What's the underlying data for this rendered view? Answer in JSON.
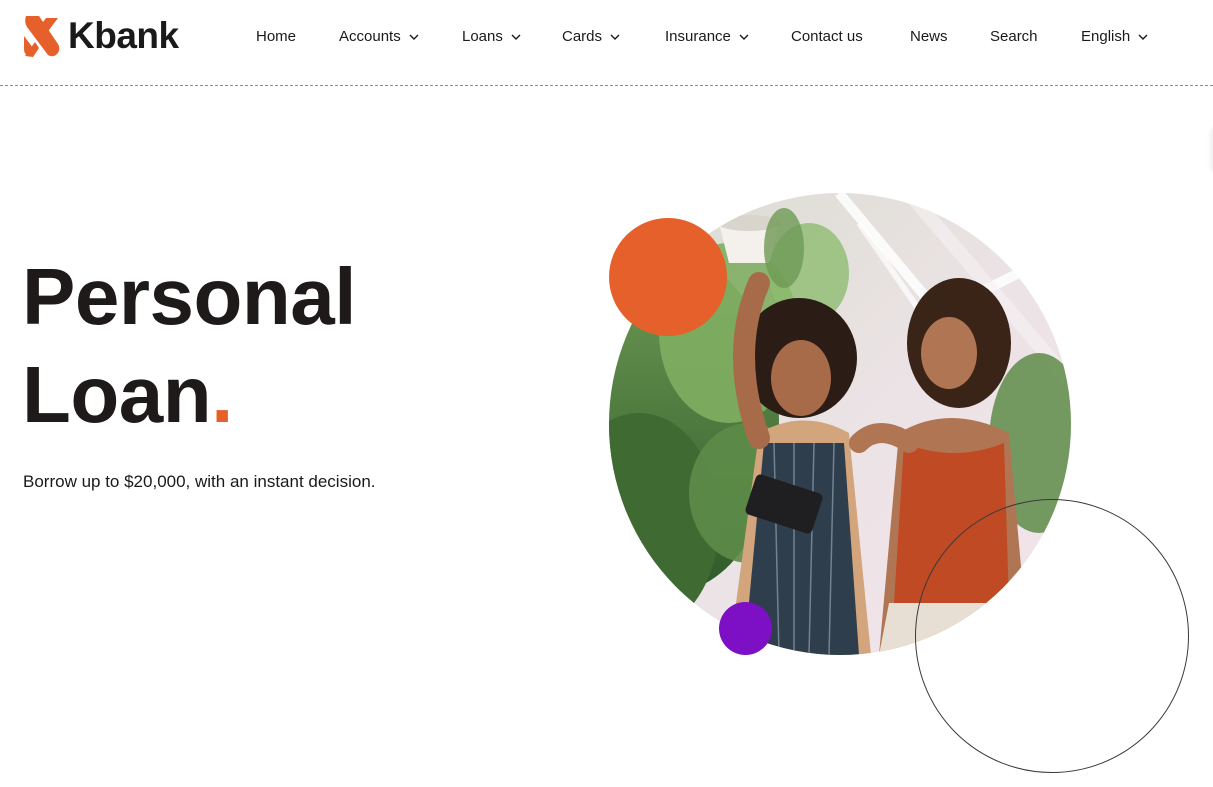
{
  "brand": {
    "name": "Kbank",
    "accent_color": "#e5602a",
    "secondary_color": "#7d0fc4",
    "logo_icon": "kbank-k-logo-icon"
  },
  "nav": {
    "items": [
      {
        "label": "Home",
        "has_dropdown": false
      },
      {
        "label": "Accounts",
        "has_dropdown": true
      },
      {
        "label": "Loans",
        "has_dropdown": true
      },
      {
        "label": "Cards",
        "has_dropdown": true
      },
      {
        "label": "Insurance",
        "has_dropdown": true
      },
      {
        "label": "Contact us",
        "has_dropdown": false
      },
      {
        "label": "News",
        "has_dropdown": false
      },
      {
        "label": "Search",
        "has_dropdown": false
      },
      {
        "label": "English",
        "has_dropdown": true
      }
    ],
    "dropdown_icon": "chevron-down-icon"
  },
  "hero": {
    "title_line1": "Personal",
    "title_line2": "Loan",
    "title_dot": ".",
    "subtitle": "Borrow up to $20,000, with an instant decision."
  }
}
